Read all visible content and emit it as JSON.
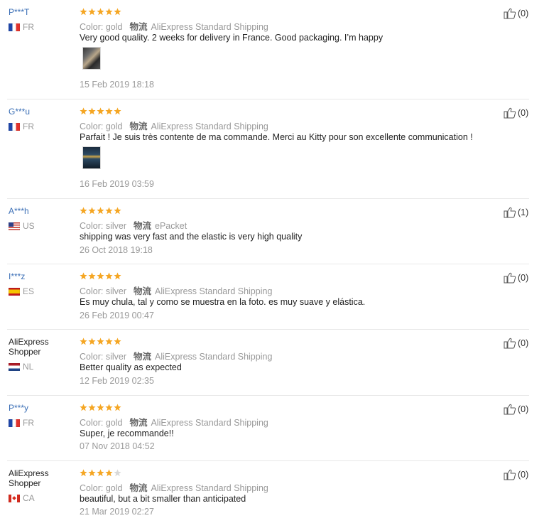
{
  "ship_label": "物流",
  "reviews": [
    {
      "user": "P***T",
      "country": "FR",
      "flag": "fr",
      "rating": 5,
      "color": "Color: gold",
      "shipping": "AliExpress Standard Shipping",
      "text": "Very good quality. 2 weeks for delivery in France. Good packaging. I’m happy",
      "has_photo": true,
      "date": "15 Feb 2019 18:18",
      "helpful": "(0)"
    },
    {
      "user": "G***u",
      "country": "FR",
      "flag": "fr",
      "rating": 5,
      "color": "Color: gold",
      "shipping": "AliExpress Standard Shipping",
      "text": "Parfait ! Je suis très contente de ma commande. Merci au Kitty pour son excellente communication !",
      "has_photo": true,
      "date": "16 Feb 2019 03:59",
      "helpful": "(0)"
    },
    {
      "user": "A***h",
      "country": "US",
      "flag": "us",
      "rating": 5,
      "color": "Color: silver",
      "shipping": "ePacket",
      "text": "shipping was very fast and the elastic is very high quality",
      "has_photo": false,
      "date": "26 Oct 2018 19:18",
      "helpful": "(1)"
    },
    {
      "user": "I***z",
      "country": "ES",
      "flag": "es",
      "rating": 5,
      "color": "Color: silver",
      "shipping": "AliExpress Standard Shipping",
      "text": "Es muy chula, tal y como se muestra en la foto. es muy suave y elástica.",
      "has_photo": false,
      "date": "26 Feb 2019 00:47",
      "helpful": "(0)"
    },
    {
      "user": "AliExpress Shopper",
      "country": "NL",
      "flag": "nl",
      "rating": 5,
      "color": "Color: silver",
      "shipping": "AliExpress Standard Shipping",
      "text": "Better quality as expected",
      "has_photo": false,
      "date": "12 Feb 2019 02:35",
      "helpful": "(0)"
    },
    {
      "user": "P***y",
      "country": "FR",
      "flag": "fr",
      "rating": 5,
      "color": "Color: gold",
      "shipping": "AliExpress Standard Shipping",
      "text": "Super, je recommande!!",
      "has_photo": false,
      "date": "07 Nov 2018 04:52",
      "helpful": "(0)"
    },
    {
      "user": "AliExpress Shopper",
      "country": "CA",
      "flag": "ca",
      "rating": 4,
      "color": "Color: gold",
      "shipping": "AliExpress Standard Shipping",
      "text": "beautiful, but a bit smaller than anticipated",
      "has_photo": false,
      "date": "21 Mar 2019 02:27",
      "helpful": "(0)"
    }
  ],
  "colors": {
    "star_filled": "#f5a623",
    "star_empty": "#d8d8d8",
    "username_link": "#3b6fb6",
    "divider": "#e8e8e8",
    "meta": "#999999"
  }
}
